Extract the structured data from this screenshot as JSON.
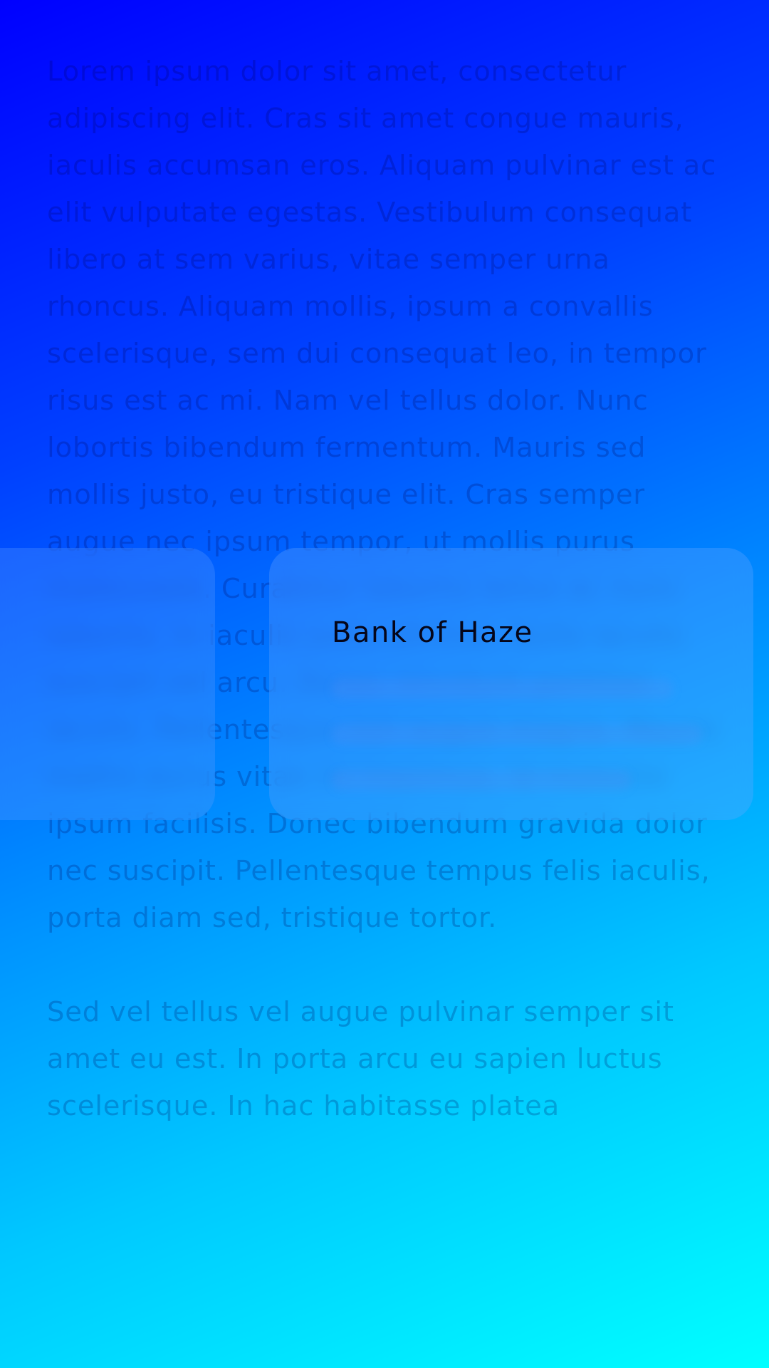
{
  "background": {
    "paragraphs": [
      "Lorem ipsum dolor sit amet, consectetur adipiscing elit. Cras sit amet congue mauris, iaculis accumsan eros. Aliquam pulvinar est ac elit vulputate egestas. Vestibulum consequat libero at sem varius, vitae semper urna rhoncus. Aliquam mollis, ipsum a convallis scelerisque, sem dui consequat leo, in tempor risus est ac mi. Nam vel tellus dolor. Nunc lobortis bibendum fermentum. Mauris sed mollis justo, eu tristique elit. Cras semper augue nec ipsum tempor, ut mollis purus malesuada. Curabitur lobortis tellus ac nunc lobortis, in iaculis justo ultrices. Nulla iaculis suscipit vel arcu. Donec tincidunt porttitor iaculis. Pellentesque non augue magna. Mauris mattis purus vitae mi maximus, id molestie ipsum facilisis. Donec bibendum gravida dolor nec suscipit. Pellentesque tempus felis iaculis, porta diam sed, tristique tortor.",
      "Sed vel tellus vel augue pulvinar semper sit amet eu est. In porta arcu eu sapien luctus scelerisque. In hac habitasse platea"
    ]
  },
  "cards": {
    "main": {
      "title": "Bank of Haze"
    }
  },
  "colors": {
    "gradient_start": "#0000ff",
    "gradient_end": "#00ffff"
  }
}
